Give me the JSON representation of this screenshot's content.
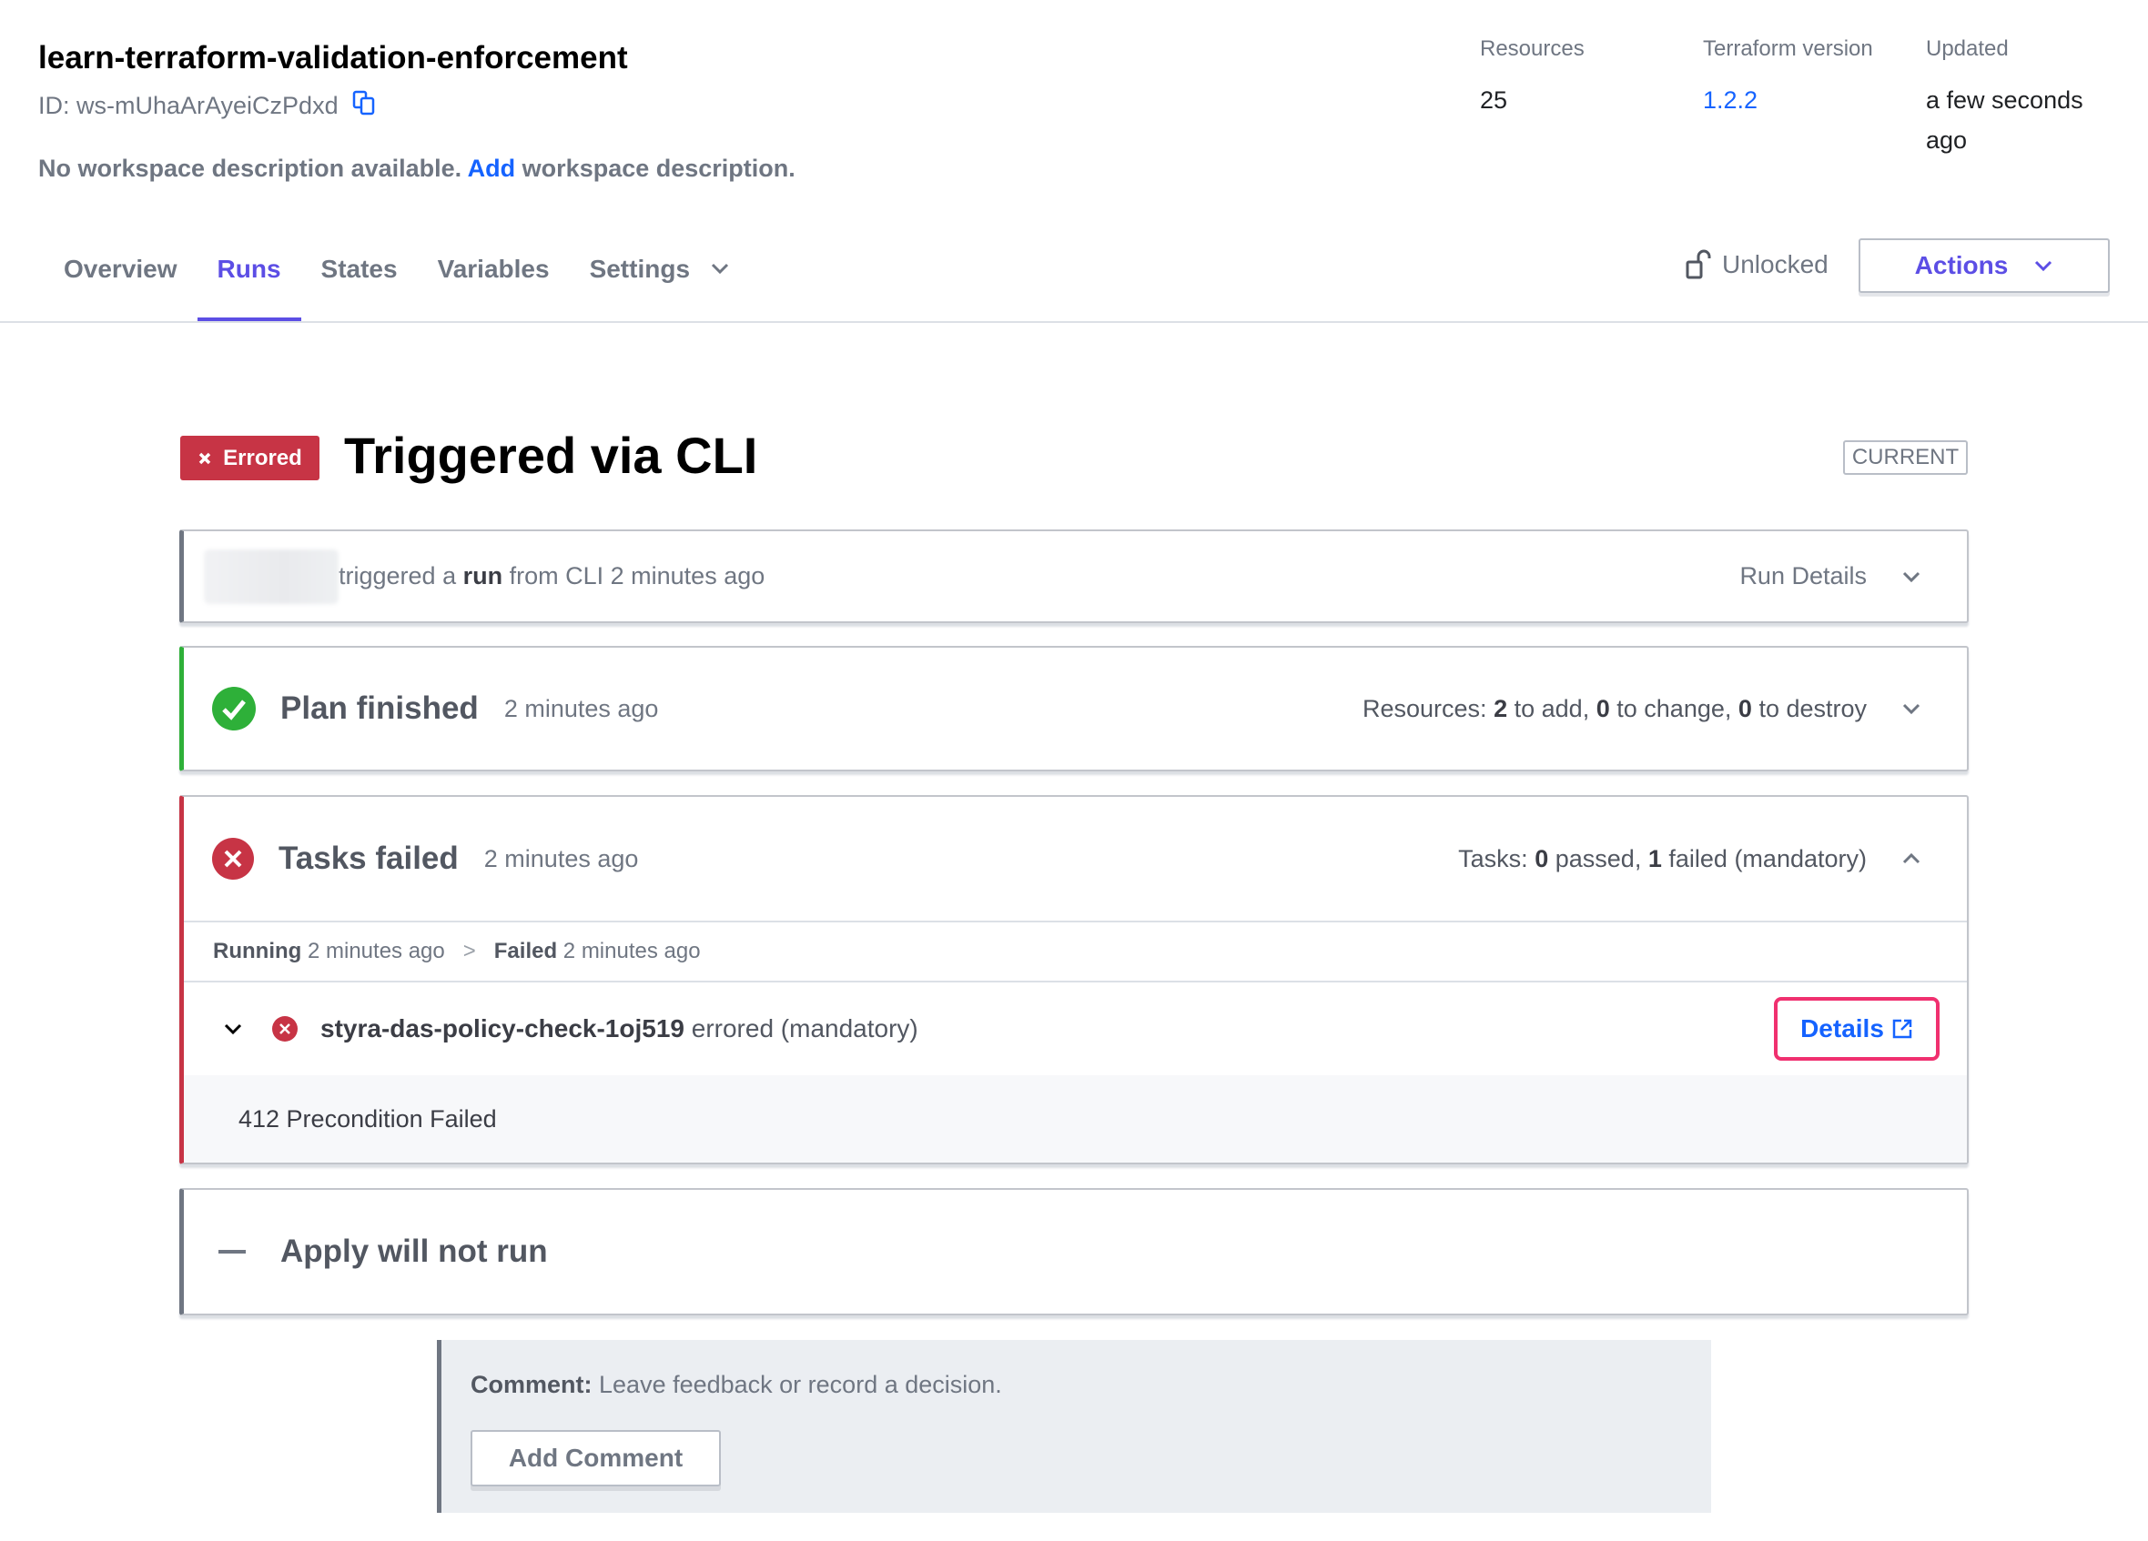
{
  "workspace": {
    "name": "learn-terraform-validation-enforcement",
    "id_label": "ID: ws-mUhaArAyeiCzPdxd",
    "copy_icon": "copy-icon",
    "desc_prefix": "No workspace description available.",
    "desc_link": "Add",
    "desc_suffix": "workspace description."
  },
  "meta": [
    {
      "label": "Resources",
      "value": "25"
    },
    {
      "label": "Terraform version",
      "value": "1.2.2"
    },
    {
      "label": "Updated",
      "value": "a few seconds ago"
    }
  ],
  "tabs": [
    {
      "label": "Overview"
    },
    {
      "label": "Runs",
      "active": true
    },
    {
      "label": "States"
    },
    {
      "label": "Variables"
    },
    {
      "label": "Settings",
      "has_dropdown": true
    }
  ],
  "lock": {
    "label": "Unlocked",
    "icon": "unlock-icon"
  },
  "actions": {
    "label": "Actions"
  },
  "run": {
    "status_badge": "Errored",
    "title": "Triggered via CLI",
    "current_label": "CURRENT",
    "trigger": {
      "prefix": "triggered a",
      "run_word": "run",
      "suffix": "from CLI 2 minutes ago",
      "details_label": "Run Details"
    },
    "plan": {
      "title": "Plan finished",
      "time": "2 minutes ago",
      "summary_prefix": "Resources:",
      "to_add": "2",
      "to_add_label": "to add,",
      "to_change": "0",
      "to_change_label": "to change,",
      "to_destroy": "0",
      "to_destroy_label": "to destroy"
    },
    "tasks": {
      "title": "Tasks failed",
      "time": "2 minutes ago",
      "summary_prefix": "Tasks:",
      "passed": "0",
      "passed_label": "passed,",
      "failed": "1",
      "failed_label": "failed (mandatory)",
      "timeline": [
        {
          "state": "Running",
          "time": "2 minutes ago"
        },
        {
          "state": "Failed",
          "time": "2 minutes ago"
        }
      ],
      "separator": ">",
      "task_name": "styra-das-policy-check-1oj519",
      "task_status": "errored (mandatory)",
      "details_label": "Details",
      "error_message": "412 Precondition Failed"
    },
    "apply": {
      "title": "Apply will not run"
    }
  },
  "comment": {
    "label": "Comment:",
    "text": "Leave feedback or record a decision.",
    "button": "Add Comment"
  },
  "colors": {
    "accent": "#5c4ee5",
    "link": "#1563ff",
    "error": "#c73445",
    "success": "#2eb039",
    "highlight": "#f0306f"
  }
}
